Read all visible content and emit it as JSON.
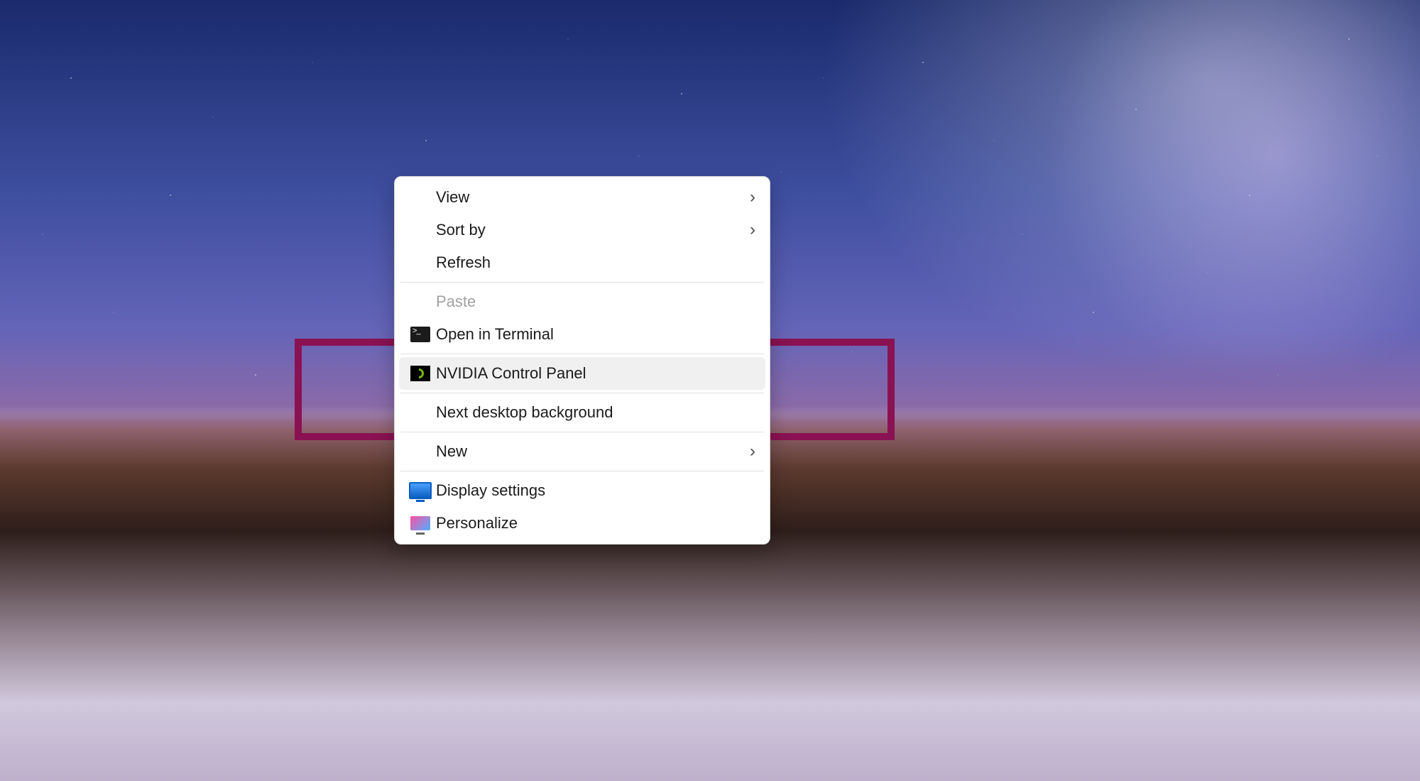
{
  "context_menu": {
    "items": {
      "view": {
        "label": "View"
      },
      "sort_by": {
        "label": "Sort by"
      },
      "refresh": {
        "label": "Refresh"
      },
      "paste": {
        "label": "Paste"
      },
      "open_terminal": {
        "label": "Open in Terminal"
      },
      "nvidia": {
        "label": "NVIDIA Control Panel"
      },
      "next_bg": {
        "label": "Next desktop background"
      },
      "new": {
        "label": "New"
      },
      "display_settings": {
        "label": "Display settings"
      },
      "personalize": {
        "label": "Personalize"
      }
    }
  },
  "annotation": {
    "highlight_color": "#8a1253"
  }
}
